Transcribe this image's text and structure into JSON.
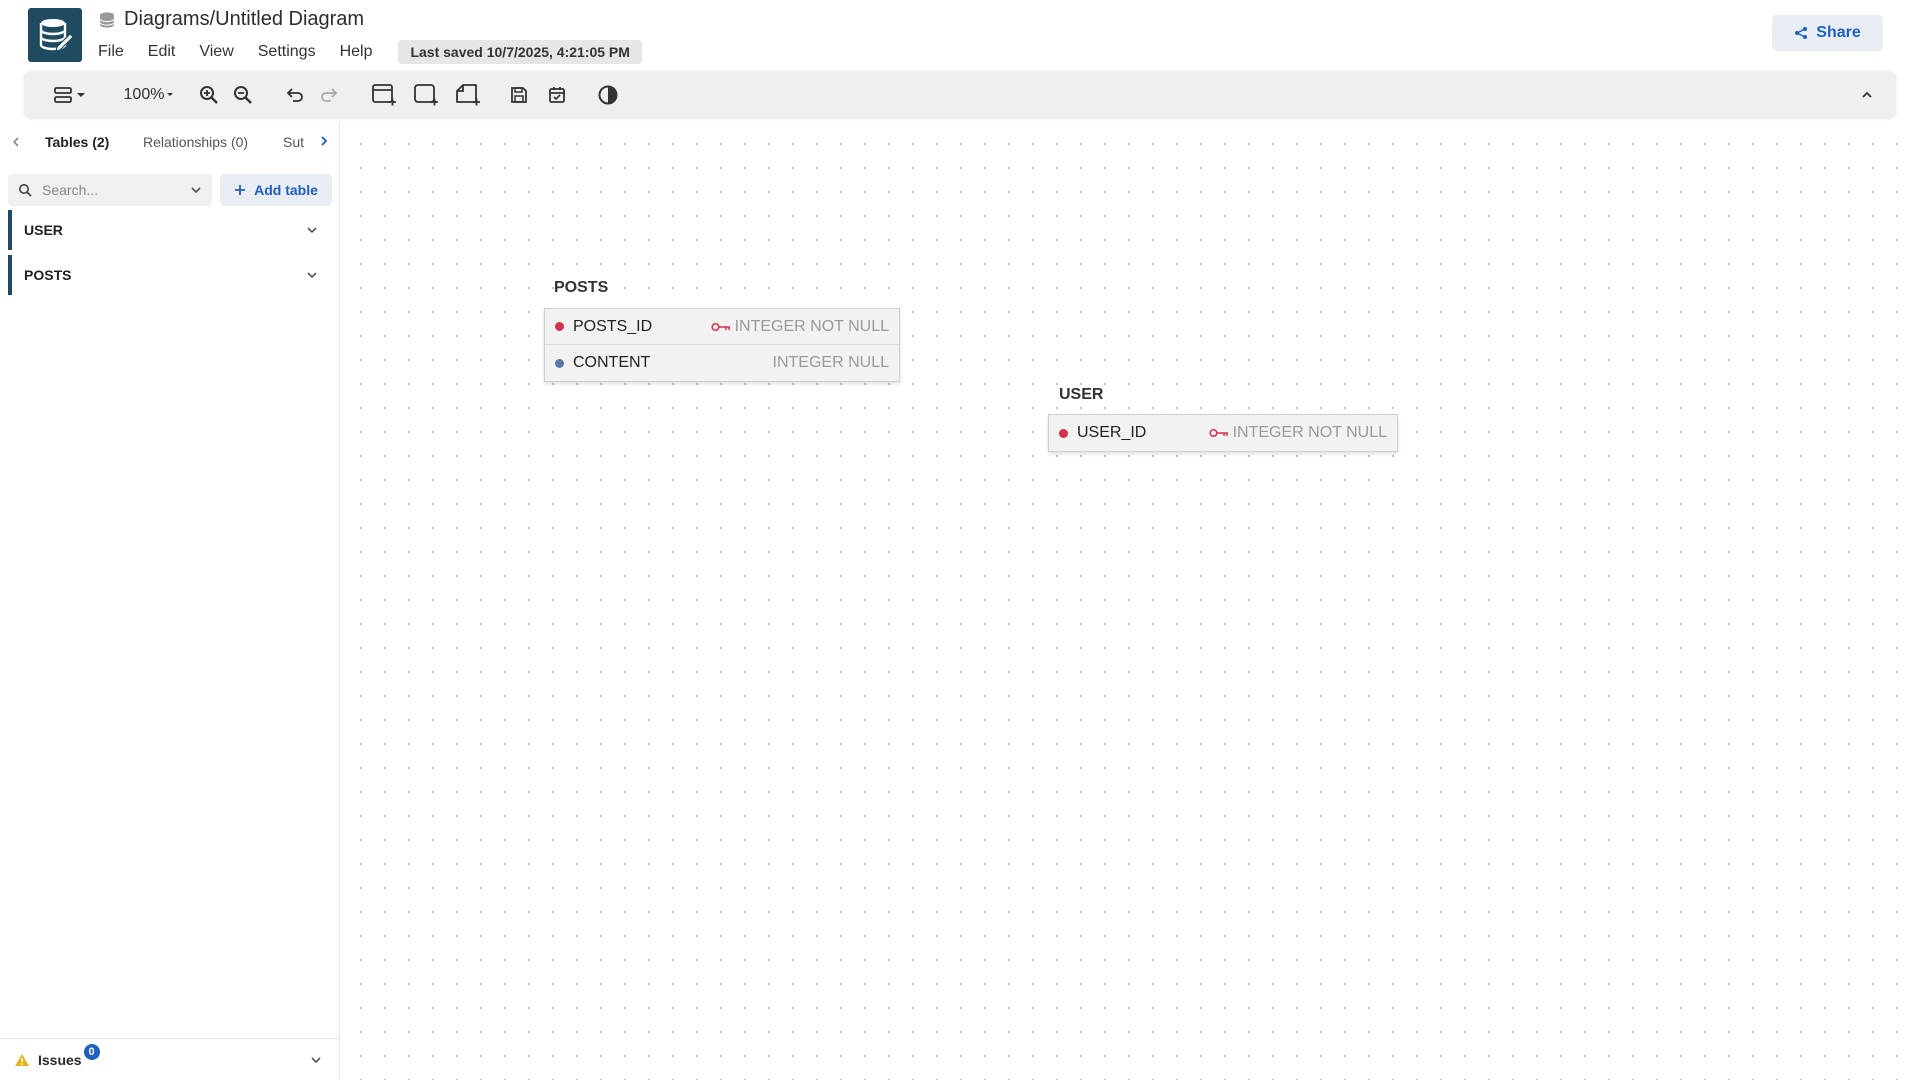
{
  "header": {
    "title": "Diagrams/Untitled Diagram",
    "menu": [
      "File",
      "Edit",
      "View",
      "Settings",
      "Help"
    ],
    "last_saved": "Last saved 10/7/2025, 4:21:05 PM",
    "share_label": "Share"
  },
  "toolbar": {
    "zoom": "100%"
  },
  "sidebar": {
    "tabs": [
      "Tables (2)",
      "Relationships (0)",
      "Sut"
    ],
    "search_placeholder": "Search...",
    "add_table_label": "Add table",
    "tables": [
      "USER",
      "POSTS"
    ],
    "issues_label": "Issues",
    "issues_count": "0"
  },
  "canvas": {
    "tables": [
      {
        "name": "POSTS",
        "fields": [
          {
            "name": "POSTS_ID",
            "type": "INTEGER NOT NULL",
            "primary_key": true,
            "dot_color": "#d6304f"
          },
          {
            "name": "CONTENT",
            "type": "INTEGER NULL",
            "primary_key": false,
            "dot_color": "#5a78a8"
          }
        ]
      },
      {
        "name": "USER",
        "fields": [
          {
            "name": "USER_ID",
            "type": "INTEGER NOT NULL",
            "primary_key": true,
            "dot_color": "#d6304f"
          }
        ]
      }
    ]
  },
  "colors": {
    "brand": "#1e4b5f",
    "accent": "#1f5fbf",
    "primary_key": "#d6304f"
  }
}
